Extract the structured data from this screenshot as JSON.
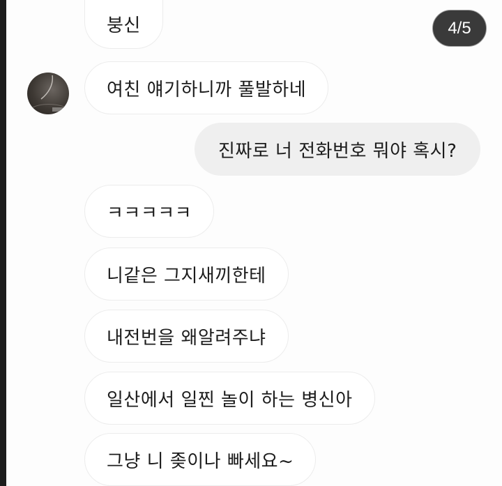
{
  "page_counter": "4/5",
  "avatar": {
    "icon": "profile-photo"
  },
  "messages": [
    {
      "direction": "incoming",
      "text": "붕신"
    },
    {
      "direction": "incoming",
      "text": "여친 얘기하니까 풀발하네"
    },
    {
      "direction": "outgoing",
      "text": "진짜로 너 전화번호 뭐야 혹시?"
    },
    {
      "direction": "incoming",
      "text": "ㅋㅋㅋㅋㅋ"
    },
    {
      "direction": "incoming",
      "text": "니같은 그지새끼한테"
    },
    {
      "direction": "incoming",
      "text": "내전번을 왜알려주냐"
    },
    {
      "direction": "incoming",
      "text": "일산에서 일찐 놀이 하는 병신아"
    },
    {
      "direction": "incoming",
      "text": "그냥 니 좆이나 빠세요~"
    }
  ]
}
